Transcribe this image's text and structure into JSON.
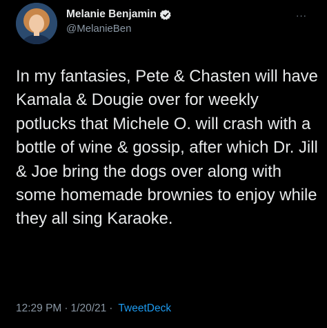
{
  "tweet": {
    "author_name": "Melanie Benjamin",
    "author_handle": "@MelanieBen",
    "verified": true,
    "more_label": "···",
    "text": "In my fantasies, Pete & Chasten will have Kamala & Dougie over for weekly potlucks that Michele O. will crash with a bottle of wine & gossip, after which Dr. Jill & Joe bring the dogs over along with some homemade brownies to enjoy while they all sing Karaoke.",
    "time": "12:29 PM",
    "date": "1/20/21",
    "separator": "·",
    "source": "TweetDeck"
  },
  "colors": {
    "background": "#000000",
    "text": "#e7e9ea",
    "secondary": "#8b98a5",
    "accent": "#1d9bf0"
  },
  "icons": {
    "verified": "verified-badge-icon",
    "more": "more-options-icon"
  }
}
